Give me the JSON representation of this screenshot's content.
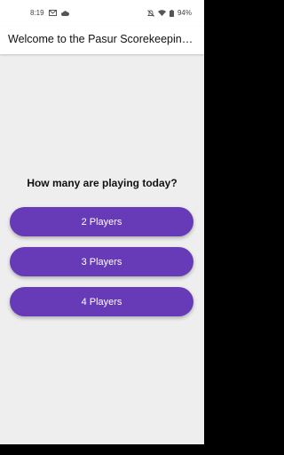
{
  "status_bar": {
    "time": "8:19",
    "battery": "94%",
    "left_icons": [
      "gmail-icon",
      "cloud-icon"
    ],
    "right_icons": [
      "mute-icon",
      "wifi-icon",
      "battery-icon"
    ]
  },
  "app_bar": {
    "title": "Welcome to the Pasur Scorekeeping App"
  },
  "main": {
    "question": "How many are playing today?",
    "options": [
      {
        "label": "2 Players"
      },
      {
        "label": "3 Players"
      },
      {
        "label": "4 Players"
      }
    ]
  },
  "colors": {
    "accent": "#673ab7",
    "background": "#eeeeee"
  }
}
